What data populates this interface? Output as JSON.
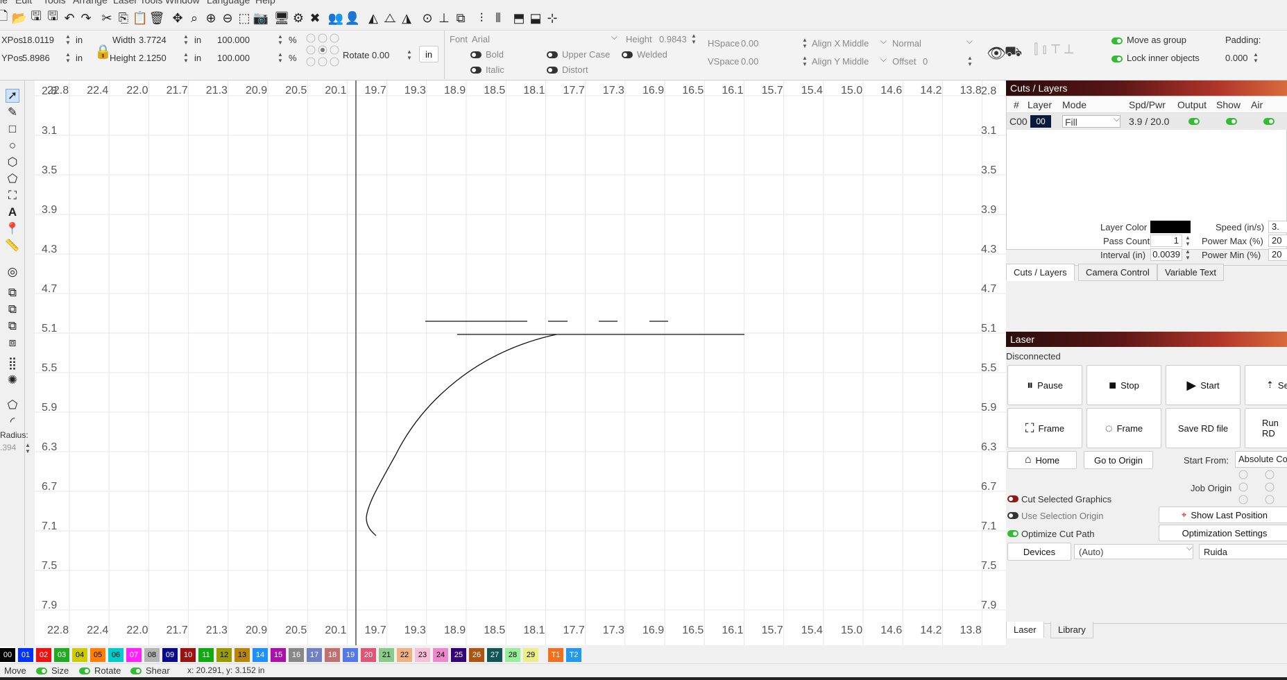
{
  "menubar": {
    "items": [
      "le",
      "Edit",
      "Tools",
      "Arrange",
      "Laser Tools",
      "Window",
      "Language",
      "Help"
    ]
  },
  "props": {
    "xpos_label": "XPos",
    "xpos_value": "18.0119",
    "xpos_unit": "in",
    "ypos_label": "YPos",
    "ypos_value": "5.8986",
    "ypos_unit": "in",
    "width_label": "Width",
    "width_value": "3.7724",
    "width_unit": "in",
    "height_label": "Height",
    "height_value": "2.1250",
    "height_unit": "in",
    "scale_w": "100.000",
    "scale_h": "100.000",
    "percent": "%",
    "rotate_label": "Rotate",
    "rotate_value": "0.00",
    "unit_button": "in",
    "font_label": "Font",
    "font_value": "Arial",
    "font_height_label": "Height",
    "font_height_value": "0.9843",
    "bold": "Bold",
    "italic": "Italic",
    "upper_case": "Upper Case",
    "distort": "Distort",
    "welded": "Welded",
    "hspace_label": "HSpace",
    "hspace_value": "0.00",
    "vspace_label": "VSpace",
    "vspace_value": "0.00",
    "alignx_label": "Align X",
    "alignx_value": "Middle",
    "aligny_label": "Align Y",
    "aligny_value": "Middle",
    "normal_value": "Normal",
    "offset_label": "Offset",
    "offset_value": "0",
    "move_as_group": "Move as group",
    "lock_inner": "Lock inner objects",
    "padding_label": "Padding:",
    "padding_value": "0.000"
  },
  "lefttools": {
    "radius_label": "Radius:",
    "radius_value": ".394"
  },
  "ruler": {
    "top": [
      "22.8",
      "22.4",
      "22.0",
      "21.7",
      "21.3",
      "20.9",
      "20.5",
      "20.1",
      "19.7",
      "19.3",
      "18.9",
      "18.5",
      "18.1",
      "17.7",
      "17.3",
      "16.9",
      "16.5",
      "16.1",
      "15.7",
      "15.4",
      "15.0",
      "14.6",
      "14.2",
      "13.8"
    ],
    "bottom": [
      "22.8",
      "22.4",
      "22.0",
      "21.7",
      "21.3",
      "20.9",
      "20.5",
      "20.1",
      "19.7",
      "19.3",
      "18.9",
      "18.5",
      "18.1",
      "17.7",
      "17.3",
      "16.9",
      "16.5",
      "16.1",
      "15.7",
      "15.4",
      "15.0",
      "14.6",
      "14.2",
      "13.8"
    ],
    "left": [
      "2.8",
      "3.1",
      "3.5",
      "3.9",
      "4.3",
      "4.7",
      "5.1",
      "5.5",
      "5.9",
      "6.3",
      "6.7",
      "7.1",
      "7.5",
      "7.9"
    ],
    "right": [
      "2.8",
      "3.1",
      "3.5",
      "3.9",
      "4.3",
      "4.7",
      "5.1",
      "5.5",
      "5.9",
      "6.3",
      "6.7",
      "7.1",
      "7.5",
      "7.9"
    ]
  },
  "cuts": {
    "title": "Cuts / Layers",
    "headers": [
      "#",
      "Layer",
      "Mode",
      "Spd/Pwr",
      "Output",
      "Show",
      "Air"
    ],
    "row": {
      "num": "C00",
      "layer": "00",
      "mode": "Fill",
      "spdpwr": "3.9 / 20.0"
    },
    "layer_color_label": "Layer Color",
    "speed_label": "Speed (in/s)",
    "speed_value": "3.",
    "pass_count_label": "Pass Count",
    "pass_count_value": "1",
    "power_max_label": "Power Max (%)",
    "power_max_value": "20",
    "interval_label": "Interval (in)",
    "interval_value": "0.0039",
    "power_min_label": "Power Min (%)",
    "power_min_value": "20",
    "tabs": [
      "Cuts / Layers",
      "Camera Control",
      "Variable Text"
    ]
  },
  "laser": {
    "title": "Laser",
    "status": "Disconnected",
    "pause": "Pause",
    "stop": "Stop",
    "start": "Start",
    "send": "Se",
    "frame1": "Frame",
    "frame2": "Frame",
    "save_rd": "Save RD file",
    "run_rd": "Run RD",
    "home": "Home",
    "goto_origin": "Go to Origin",
    "start_from_label": "Start From:",
    "start_from_value": "Absolute Coo",
    "job_origin_label": "Job Origin",
    "cut_selected": "Cut Selected Graphics",
    "use_selection_origin": "Use Selection Origin",
    "optimize_cut_path": "Optimize Cut Path",
    "show_last_position": "Show Last Position",
    "optimization_settings": "Optimization Settings",
    "devices": "Devices",
    "device_value": "(Auto)",
    "controller": "Ruida",
    "tabs": [
      "Laser",
      "Library"
    ]
  },
  "palette": [
    {
      "l": "00",
      "c": "#000000",
      "t": "#fff"
    },
    {
      "l": "01",
      "c": "#0033ff",
      "t": "#fff"
    },
    {
      "l": "02",
      "c": "#ee1111",
      "t": "#fff"
    },
    {
      "l": "03",
      "c": "#22aa22",
      "t": "#fff"
    },
    {
      "l": "04",
      "c": "#cccc00",
      "t": "#000"
    },
    {
      "l": "05",
      "c": "#ff7f00",
      "t": "#000"
    },
    {
      "l": "06",
      "c": "#00cccc",
      "t": "#000"
    },
    {
      "l": "07",
      "c": "#ff22ff",
      "t": "#fff"
    },
    {
      "l": "08",
      "c": "#b4b4b4",
      "t": "#000"
    },
    {
      "l": "09",
      "c": "#0a0a8a",
      "t": "#fff"
    },
    {
      "l": "10",
      "c": "#991111",
      "t": "#fff"
    },
    {
      "l": "11",
      "c": "#11aa11",
      "t": "#fff"
    },
    {
      "l": "12",
      "c": "#999900",
      "t": "#000"
    },
    {
      "l": "13",
      "c": "#b8860b",
      "t": "#000"
    },
    {
      "l": "14",
      "c": "#1e90ff",
      "t": "#fff"
    },
    {
      "l": "15",
      "c": "#aa11aa",
      "t": "#fff"
    },
    {
      "l": "16",
      "c": "#888888",
      "t": "#fff"
    },
    {
      "l": "17",
      "c": "#7080c0",
      "t": "#fff"
    },
    {
      "l": "18",
      "c": "#c07070",
      "t": "#fff"
    },
    {
      "l": "19",
      "c": "#5577ee",
      "t": "#fff"
    },
    {
      "l": "20",
      "c": "#dd5577",
      "t": "#fff"
    },
    {
      "l": "21",
      "c": "#88cc88",
      "t": "#000"
    },
    {
      "l": "22",
      "c": "#f0b080",
      "t": "#000"
    },
    {
      "l": "23",
      "c": "#f8c0d8",
      "t": "#000"
    },
    {
      "l": "24",
      "c": "#ee88cc",
      "t": "#000"
    },
    {
      "l": "25",
      "c": "#330077",
      "t": "#fff"
    },
    {
      "l": "26",
      "c": "#aa5511",
      "t": "#fff"
    },
    {
      "l": "27",
      "c": "#115555",
      "t": "#fff"
    },
    {
      "l": "28",
      "c": "#99ee99",
      "t": "#000"
    },
    {
      "l": "29",
      "c": "#eeee88",
      "t": "#000"
    },
    {
      "l": "T1",
      "c": "#f07020",
      "t": "#fff"
    },
    {
      "l": "T2",
      "c": "#2299ee",
      "t": "#fff"
    }
  ],
  "status": {
    "move": "Move",
    "size": "Size",
    "rotate": "Rotate",
    "shear": "Shear",
    "coords": "x: 20.291, y: 3.152 in"
  },
  "colors": {
    "panel_header": "#5a1616",
    "toggle_on": "#33bb33",
    "layer_00": "#0a1a3a"
  }
}
